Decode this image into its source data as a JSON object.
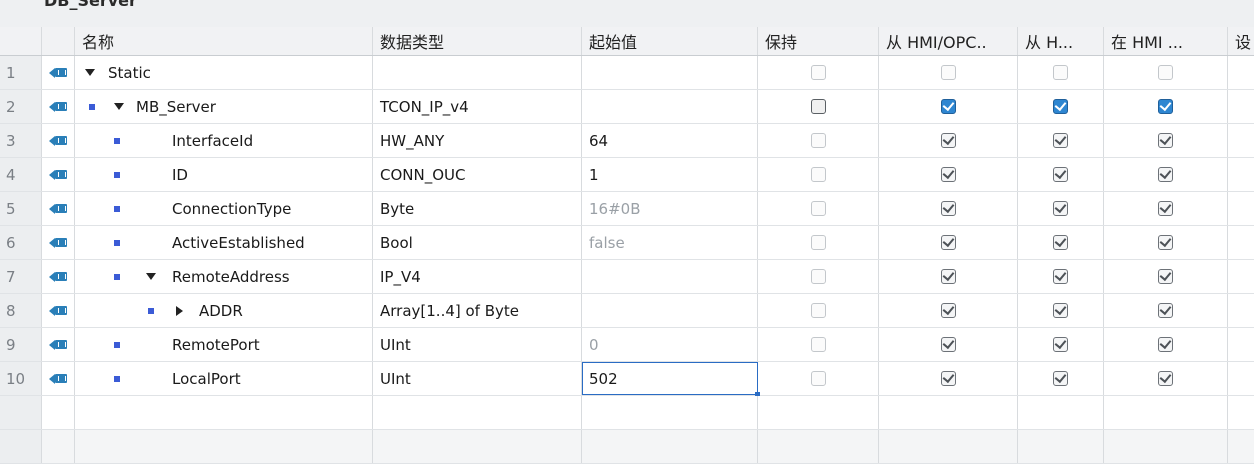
{
  "title": "DB_Server",
  "columns": {
    "name": "名称",
    "type": "数据类型",
    "start": "起始值",
    "keep": "保持",
    "hmi1": "从 HMI/OPC..",
    "hmi2": "从 H...",
    "hmi3": "在 HMI ...",
    "last": "设"
  },
  "rows": [
    {
      "num": "1",
      "name": "Static",
      "type": "",
      "start": "",
      "level": 0,
      "expander": "down",
      "bullet": false,
      "checks": [
        "empty",
        "empty",
        "empty",
        "empty"
      ],
      "start_muted": false
    },
    {
      "num": "2",
      "name": "MB_Server",
      "type": "TCON_IP_v4",
      "start": "",
      "level": 1,
      "expander": "down",
      "bullet": true,
      "checks": [
        "dark",
        "blue",
        "blue",
        "blue"
      ],
      "start_muted": false
    },
    {
      "num": "3",
      "name": "InterfaceId",
      "type": "HW_ANY",
      "start": "64",
      "level": 2,
      "expander": "none",
      "bullet": true,
      "checks": [
        "empty",
        "grey",
        "grey",
        "grey"
      ],
      "start_muted": false
    },
    {
      "num": "4",
      "name": "ID",
      "type": "CONN_OUC",
      "start": "1",
      "level": 2,
      "expander": "none",
      "bullet": true,
      "checks": [
        "empty",
        "grey",
        "grey",
        "grey"
      ],
      "start_muted": false
    },
    {
      "num": "5",
      "name": "ConnectionType",
      "type": "Byte",
      "start": "16#0B",
      "level": 2,
      "expander": "none",
      "bullet": true,
      "checks": [
        "empty",
        "grey",
        "grey",
        "grey"
      ],
      "start_muted": true
    },
    {
      "num": "6",
      "name": "ActiveEstablished",
      "type": "Bool",
      "start": "false",
      "level": 2,
      "expander": "none",
      "bullet": true,
      "checks": [
        "empty",
        "grey",
        "grey",
        "grey"
      ],
      "start_muted": true
    },
    {
      "num": "7",
      "name": "RemoteAddress",
      "type": "IP_V4",
      "start": "",
      "level": 2,
      "expander": "down",
      "bullet": true,
      "checks": [
        "empty",
        "grey",
        "grey",
        "grey"
      ],
      "start_muted": false
    },
    {
      "num": "8",
      "name": "ADDR",
      "type": "Array[1..4] of Byte",
      "start": "",
      "level": 3,
      "expander": "right",
      "bullet": true,
      "checks": [
        "empty",
        "grey",
        "grey",
        "grey"
      ],
      "start_muted": false
    },
    {
      "num": "9",
      "name": "RemotePort",
      "type": "UInt",
      "start": "0",
      "level": 2,
      "expander": "none",
      "bullet": true,
      "checks": [
        "empty",
        "grey",
        "grey",
        "grey"
      ],
      "start_muted": true
    },
    {
      "num": "10",
      "name": "LocalPort",
      "type": "UInt",
      "start": "502",
      "level": 2,
      "expander": "none",
      "bullet": true,
      "checks": [
        "empty",
        "grey",
        "grey",
        "grey"
      ],
      "start_muted": false,
      "editing": true
    }
  ],
  "colors": {
    "accent": "#2e86d1",
    "edit_border": "#2a6cc4",
    "bullet": "#3b5bd6"
  }
}
